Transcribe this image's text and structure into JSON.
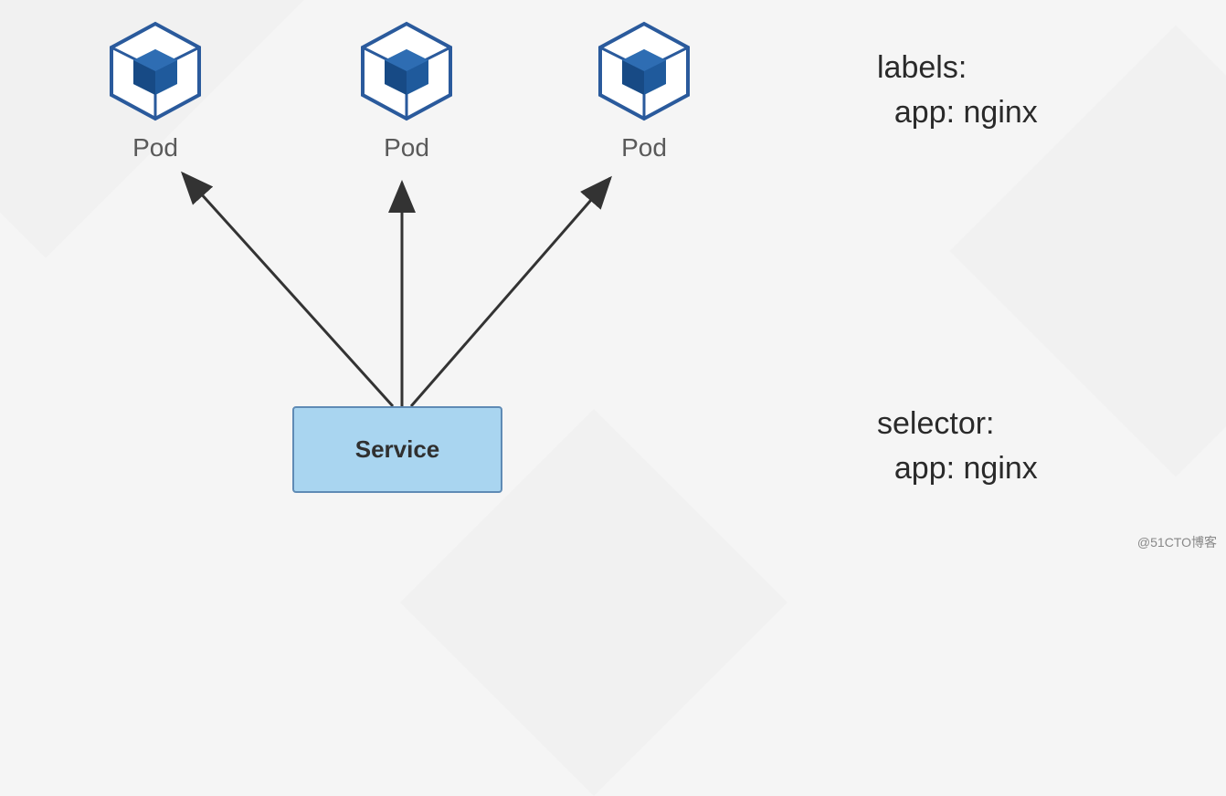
{
  "pods": [
    {
      "label": "Pod"
    },
    {
      "label": "Pod"
    },
    {
      "label": "Pod"
    }
  ],
  "service": {
    "label": "Service"
  },
  "yaml_labels": {
    "line1": "labels:",
    "line2": "  app: nginx"
  },
  "yaml_selector": {
    "line1": "selector:",
    "line2": "  app: nginx"
  },
  "watermark": "@51CTO博客"
}
